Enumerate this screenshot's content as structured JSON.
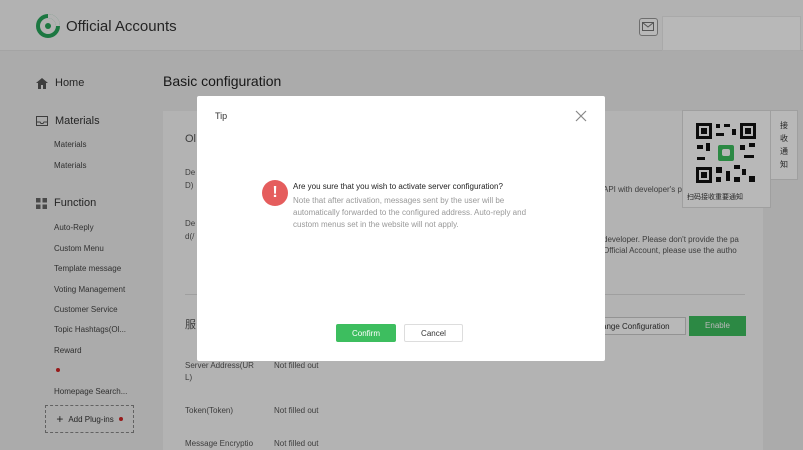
{
  "header": {
    "brand": "Official Accounts",
    "logo_icon": "official-accounts-logo",
    "mail_icon": "mail-icon"
  },
  "sidebar": {
    "home": "Home",
    "materials_head": "Materials",
    "materials_items": [
      "Materials",
      "Materials"
    ],
    "function_head": "Function",
    "function_items": [
      "Auto-Reply",
      "Custom Menu",
      "Template message",
      "Voting Management",
      "Customer Service",
      "Topic Hashtags(Ol...",
      "Reward",
      "",
      "Homepage Search..."
    ],
    "add_plugin": "Add Plug-ins"
  },
  "main": {
    "page_title": "Basic configuration",
    "section_left_fragments": [
      "Ol",
      "De",
      "D)",
      "De",
      "d(/",
      "服"
    ],
    "right_fragments": [
      "API with developer's pass...",
      "developer. Please don't provide the pa",
      "Official Account, please use the autho"
    ],
    "change_config": "ange Configuration",
    "enable": "Enable",
    "rows": [
      {
        "label_line1": "Server Address(UR",
        "label_line2": "L)",
        "value": "Not filled out"
      },
      {
        "label_line1": "Token(Token)",
        "label_line2": "",
        "value": "Not filled out"
      },
      {
        "label_line1": "Message Encryptio",
        "label_line2": "",
        "value": "Not filled out"
      }
    ]
  },
  "qr": {
    "caption": "扫码接收重要通知"
  },
  "side_notice": [
    "接",
    "收",
    "通",
    "知"
  ],
  "modal": {
    "title": "Tip",
    "question": "Are you sure that you wish to activate server configuration?",
    "note": "Note that after activation, messages sent by the user will be automatically forwarded to the configured address. Auto-reply and custom menus set in the website will not apply.",
    "confirm": "Confirm",
    "cancel": "Cancel",
    "warning_glyph": "!"
  },
  "colors": {
    "accent_green": "#3dbe5f",
    "warning_red": "#e55d5d",
    "dot_red": "#d12424"
  }
}
